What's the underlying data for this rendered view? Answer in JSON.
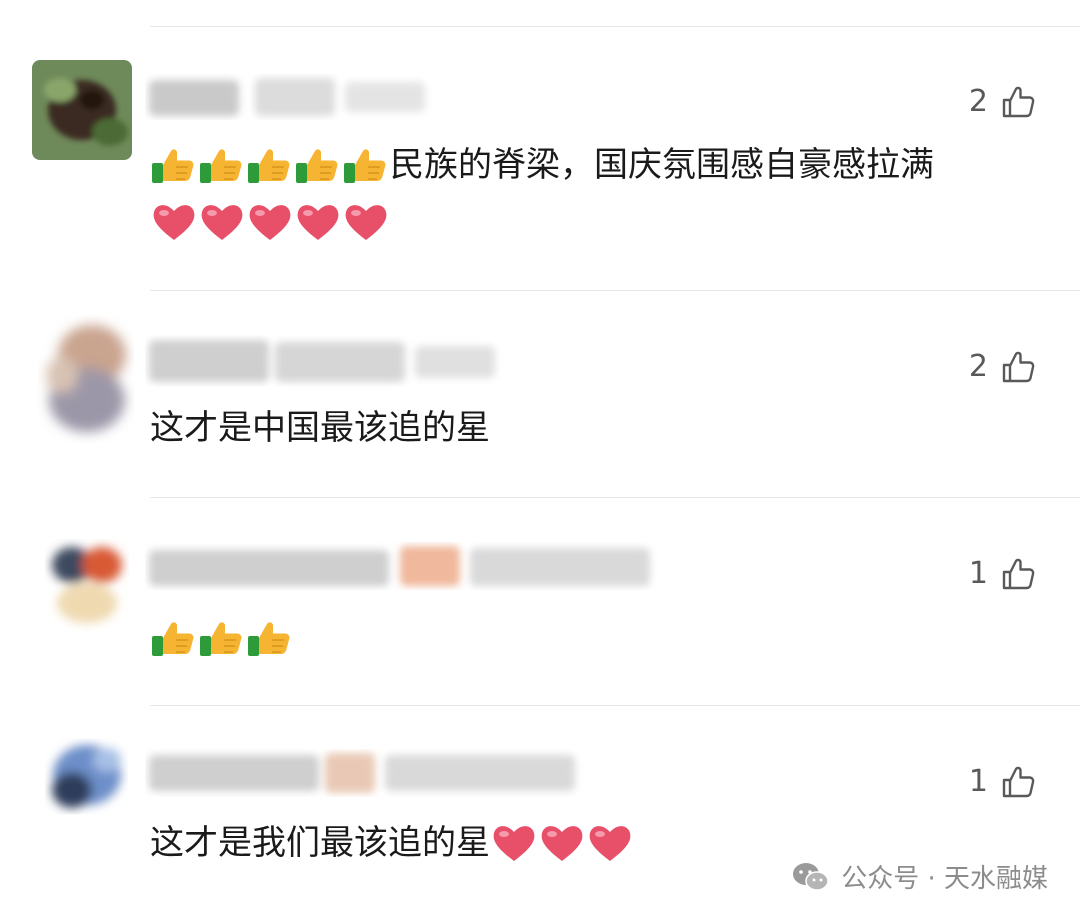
{
  "comments": [
    {
      "likes": "2",
      "text": "民族的脊梁，国庆氛围感自豪感拉满",
      "leading_emoji": {
        "name": "thumbs-up",
        "count": 5
      },
      "trailing_emoji": {
        "name": "red-heart",
        "count": 5
      }
    },
    {
      "likes": "2",
      "text": "这才是中国最该追的星"
    },
    {
      "likes": "1",
      "text": "",
      "leading_emoji": {
        "name": "thumbs-up",
        "count": 3
      }
    },
    {
      "likes": "1",
      "text": "这才是我们最该追的星",
      "trailing_emoji": {
        "name": "red-heart",
        "count": 3
      }
    }
  ],
  "watermark": {
    "text": "公众号 · 天水融媒",
    "icon": "wechat-icon"
  },
  "colors": {
    "text": "#1a1a1a",
    "like_count": "#595959",
    "divider": "#e8e8e8",
    "watermark": "#8c8c8c",
    "heart": "#e8506a",
    "thumb": "#f5b431",
    "cuff": "#2e9b3a"
  }
}
